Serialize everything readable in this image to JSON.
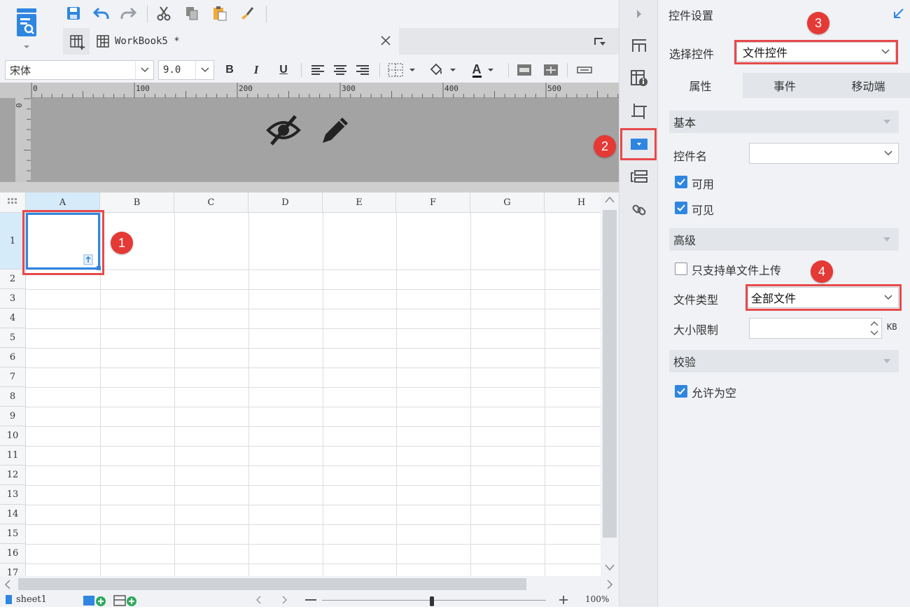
{
  "toolbar": {
    "save": "save-icon",
    "undo": "undo-icon",
    "redo": "redo-icon",
    "cut": "cut-icon",
    "copy": "copy-icon",
    "paste": "paste-icon",
    "format_painter": "format-painter-icon"
  },
  "tab": {
    "title": "WorkBook5 *"
  },
  "format": {
    "font": "宋体",
    "size": "9.0",
    "bold": "B",
    "italic": "I",
    "underline": "U",
    "font_color": "A"
  },
  "ruler": {
    "h_ticks": [
      "0",
      "100",
      "200",
      "300",
      "400",
      "500"
    ],
    "v_tick": "0"
  },
  "grid": {
    "columns": [
      "A",
      "B",
      "C",
      "D",
      "E",
      "F",
      "G",
      "H"
    ],
    "rows": [
      "1",
      "2",
      "3",
      "4",
      "5",
      "6",
      "7",
      "8",
      "9",
      "10",
      "11",
      "12",
      "13",
      "14",
      "15",
      "16",
      "17"
    ],
    "selected_cell": "A1"
  },
  "status": {
    "sheet": "sheet1",
    "zoom": "100%"
  },
  "markers": [
    "1",
    "2",
    "3",
    "4"
  ],
  "panel": {
    "title": "控件设置",
    "select_label": "选择控件",
    "select_value": "文件控件",
    "tabs": [
      "属性",
      "事件",
      "移动端"
    ],
    "basic": {
      "header": "基本",
      "name_label": "控件名",
      "name_value": "",
      "enabled_label": "可用",
      "enabled": true,
      "visible_label": "可见",
      "visible": true
    },
    "advanced": {
      "header": "高级",
      "single_file_label": "只支持单文件上传",
      "single_file": false,
      "file_type_label": "文件类型",
      "file_type_value": "全部文件",
      "size_limit_label": "大小限制",
      "size_limit_value": "",
      "size_unit": "KB"
    },
    "validation": {
      "header": "校验",
      "allow_empty_label": "允许为空",
      "allow_empty": true
    }
  },
  "colors": {
    "accent": "#2f86e0",
    "marker": "#e53935",
    "band": "#a3a3a3"
  }
}
